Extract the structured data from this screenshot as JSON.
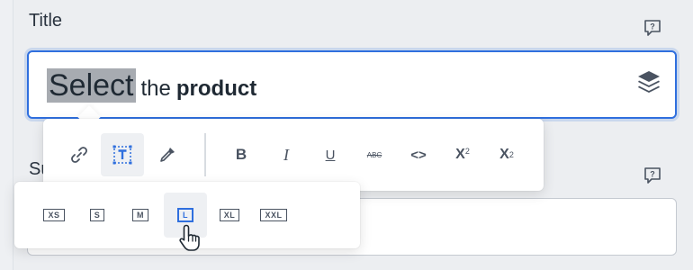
{
  "fields": {
    "title": {
      "label": "Title",
      "value_selected": "Select",
      "value_plain": "the",
      "value_bold": "product"
    },
    "subtitle": {
      "label_visible": "Su"
    }
  },
  "toolbar": {
    "buttons": [
      "link",
      "text-size",
      "color-picker",
      "B",
      "I",
      "U",
      "ABC",
      "<>",
      "X",
      "X"
    ],
    "bold": "B",
    "italic": "I",
    "underline": "U",
    "strike": "ABC",
    "code": "<>",
    "sup_base": "X",
    "sup_exp": "2",
    "sub_base": "X",
    "sub_exp": "2"
  },
  "sizes": [
    "XS",
    "S",
    "M",
    "L",
    "XL",
    "XXL"
  ],
  "selected_size": "L",
  "colors": {
    "accent": "#2f6fde",
    "icon": "#4a5361",
    "selection": "#a7abb1"
  }
}
